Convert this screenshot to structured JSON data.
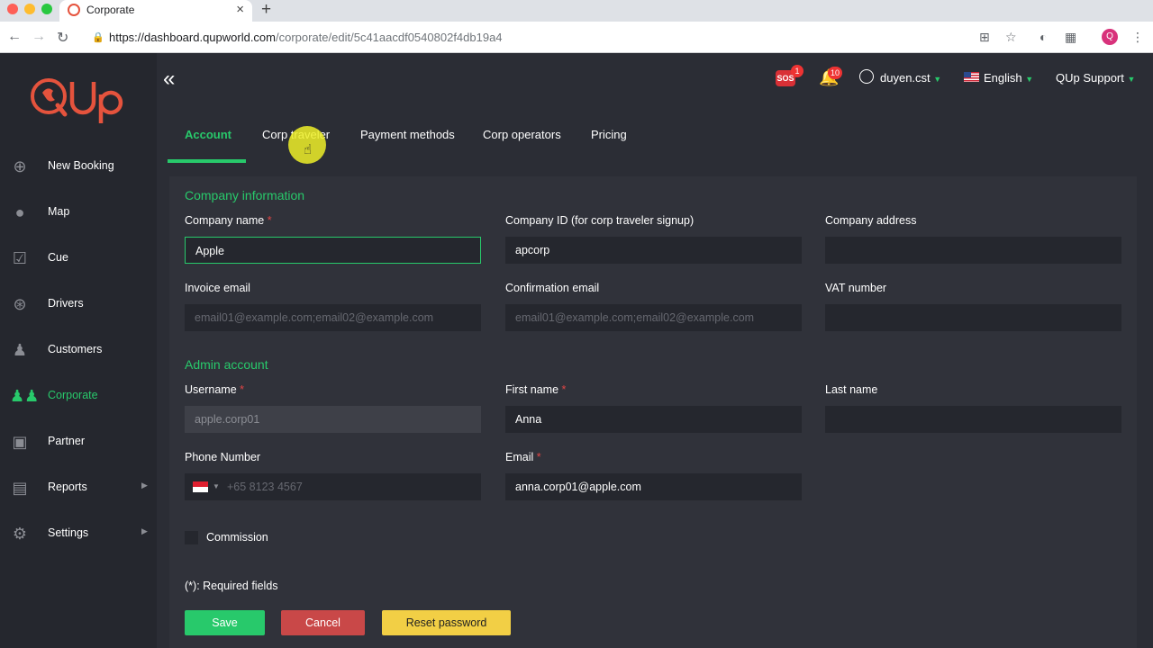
{
  "browser": {
    "tab_title": "Corporate",
    "url_host": "https://dashboard.qupworld.com",
    "url_path": "/corporate/edit/5c41aacdf0540802f4db19a4",
    "profile_initial": "Q"
  },
  "sidebar": {
    "logo_text": "QUp",
    "items": [
      {
        "label": "New Booking",
        "icon": "plus-circle-icon"
      },
      {
        "label": "Map",
        "icon": "map-pin-icon"
      },
      {
        "label": "Cue",
        "icon": "checklist-icon"
      },
      {
        "label": "Drivers",
        "icon": "steering-wheel-icon"
      },
      {
        "label": "Customers",
        "icon": "person-icon"
      },
      {
        "label": "Corporate",
        "icon": "group-icon"
      },
      {
        "label": "Partner",
        "icon": "chat-icon"
      },
      {
        "label": "Reports",
        "icon": "clipboard-icon"
      },
      {
        "label": "Settings",
        "icon": "gear-icon"
      }
    ],
    "active": "Corporate"
  },
  "header": {
    "sos_label": "SOS",
    "sos_count": "1",
    "notif_count": "10",
    "user": "duyen.cst",
    "language": "English",
    "support": "QUp Support"
  },
  "tabs": [
    "Account",
    "Corp traveler",
    "Payment methods",
    "Corp operators",
    "Pricing"
  ],
  "form": {
    "company_section": "Company information",
    "company_name_label": "Company name",
    "company_name_value": "Apple",
    "company_id_label": "Company ID (for corp traveler signup)",
    "company_id_value": "apcorp",
    "company_address_label": "Company address",
    "company_address_value": "",
    "invoice_email_label": "Invoice email",
    "invoice_email_placeholder": "email01@example.com;email02@example.com",
    "confirmation_email_label": "Confirmation email",
    "confirmation_email_placeholder": "email01@example.com;email02@example.com",
    "vat_label": "VAT number",
    "vat_value": "",
    "admin_section": "Admin account",
    "username_label": "Username",
    "username_value": "apple.corp01",
    "first_name_label": "First name",
    "first_name_value": "Anna",
    "last_name_label": "Last name",
    "last_name_value": "",
    "phone_label": "Phone Number",
    "phone_placeholder": "+65 8123 4567",
    "email_label": "Email",
    "email_value": "anna.corp01@apple.com",
    "commission_label": "Commission",
    "required_note": "(*): Required fields",
    "required_mark": "*"
  },
  "buttons": {
    "save": "Save",
    "cancel": "Cancel",
    "reset": "Reset password"
  },
  "colors": {
    "accent": "#28c96b",
    "danger": "#c94848",
    "warning": "#f2cf45",
    "background": "#2b2d35"
  }
}
